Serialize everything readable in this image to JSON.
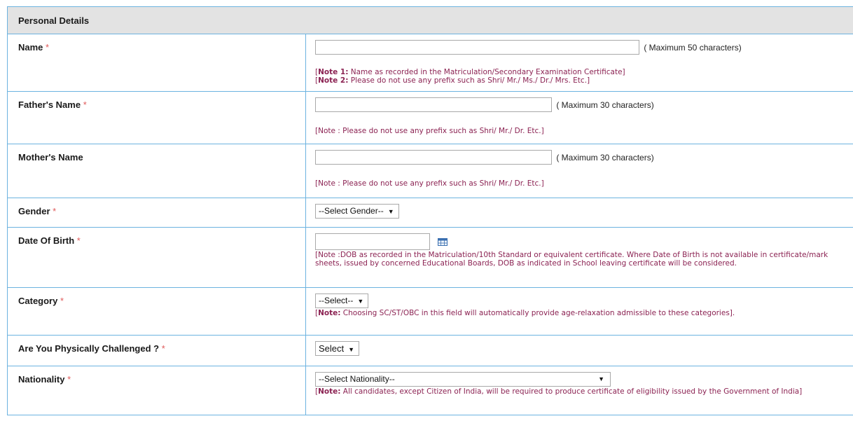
{
  "section": {
    "title": "Personal Details"
  },
  "required_mark": "*",
  "fields": {
    "name": {
      "label": "Name",
      "hint": "( Maximum 50 characters)",
      "value": "",
      "note1_prefix": "Note 1:",
      "note1_text": " Name as recorded in the Matriculation/Secondary Examination Certificate]",
      "note2_prefix": "Note 2:",
      "note2_text": " Please do not use any prefix such as Shri/ Mr./ Ms./ Dr./ Mrs. Etc.]"
    },
    "father": {
      "label": "Father's Name",
      "hint": "( Maximum 30 characters)",
      "value": "",
      "note": "[Note : Please do not use any prefix such as Shri/ Mr./ Dr. Etc.]"
    },
    "mother": {
      "label": "Mother's Name",
      "hint": "( Maximum 30 characters)",
      "value": "",
      "note": "[Note : Please do not use any prefix such as Shri/ Mr./ Dr. Etc.]"
    },
    "gender": {
      "label": "Gender",
      "selected": "--Select Gender--"
    },
    "dob": {
      "label": "Date Of Birth",
      "value": "",
      "icon": "calendar-icon",
      "note": "[Note :DOB as recorded in the Matriculation/10th Standard or equivalent certificate. Where Date of Birth is not available in certificate/mark sheets, issued by concerned Educational Boards, DOB as indicated in School leaving certificate will be considered."
    },
    "category": {
      "label": "Category",
      "selected": "--Select--",
      "note_prefix": "Note:",
      "note_text": " Choosing SC/ST/OBC in this field will automatically provide age-relaxation admissible to these categories]."
    },
    "pwd": {
      "label": "Are You Physically Challenged ?",
      "selected": "Select"
    },
    "nationality": {
      "label": "Nationality",
      "selected": "--Select Nationality--",
      "note_prefix": "Note:",
      "note_text": " All candidates, except Citizen of India, will be required to produce certificate of eligibility issued by the Government of India]"
    }
  },
  "colors": {
    "border": "#6cb3e0",
    "note": "#8b2252",
    "required": "#e05a5a",
    "header_bg": "#e3e3e3"
  }
}
